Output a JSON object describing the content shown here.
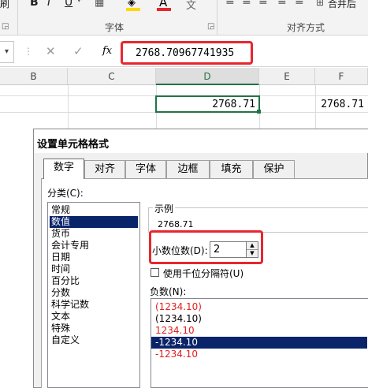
{
  "ribbon": {
    "clipboard_fragment": "刷",
    "bold": "B",
    "italic": "I",
    "underline": "U",
    "font_group_label": "字体",
    "align_group_label": "对齐方式",
    "merge_label": "合并后"
  },
  "formula_bar": {
    "cancel": "✕",
    "enter": "✓",
    "fx": "fx",
    "value": "2768.70967741935"
  },
  "grid": {
    "columns": [
      "B",
      "C",
      "D",
      "E",
      "F"
    ],
    "cells": {
      "d_value": "2768.71",
      "f_value": "2768.71"
    }
  },
  "dialog": {
    "title": "设置单元格格式",
    "tabs": [
      "数字",
      "对齐",
      "字体",
      "边框",
      "填充",
      "保护"
    ],
    "active_tab": "数字",
    "category_label": "分类(C):",
    "categories": [
      "常规",
      "数值",
      "货币",
      "会计专用",
      "日期",
      "时间",
      "百分比",
      "分数",
      "科学记数",
      "文本",
      "特殊",
      "自定义"
    ],
    "selected_category": "数值",
    "sample_label": "示例",
    "sample_value": "2768.71",
    "decimal_label": "小数位数(D):",
    "decimal_value": "2",
    "thousands_label": "使用千位分隔符(U)",
    "negative_label": "负数(N):",
    "negative_formats": [
      {
        "text": "(1234.10)",
        "color": "#e02020"
      },
      {
        "text": "(1234.10)",
        "color": "#000000"
      },
      {
        "text": "1234.10",
        "color": "#e02020"
      },
      {
        "text": "-1234.10",
        "color": "#ffffff"
      },
      {
        "text": "-1234.10",
        "color": "#e02020"
      }
    ],
    "selected_negative_index": 3
  },
  "colors": {
    "highlight_red": "#e8262e",
    "selection_blue": "#0a246a",
    "font_color_accent": "#e8262e",
    "fill_accent": "#ffd800",
    "active_cell_green": "#217346"
  }
}
